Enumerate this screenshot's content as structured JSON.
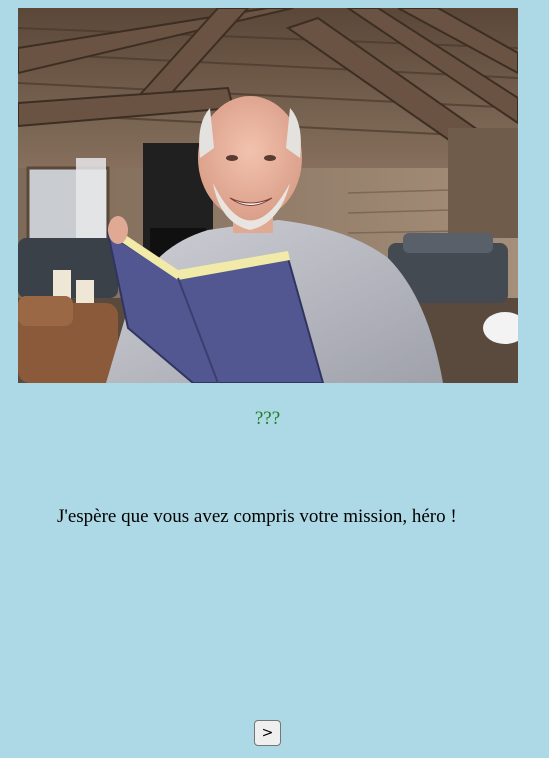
{
  "scene": {
    "image": "chalet-interior-with-smiling-man-reading-blue-book"
  },
  "dialogue": {
    "speaker": "???",
    "text": "J'espère que vous avez compris votre mission, héro !"
  },
  "controls": {
    "next_label": ">"
  }
}
